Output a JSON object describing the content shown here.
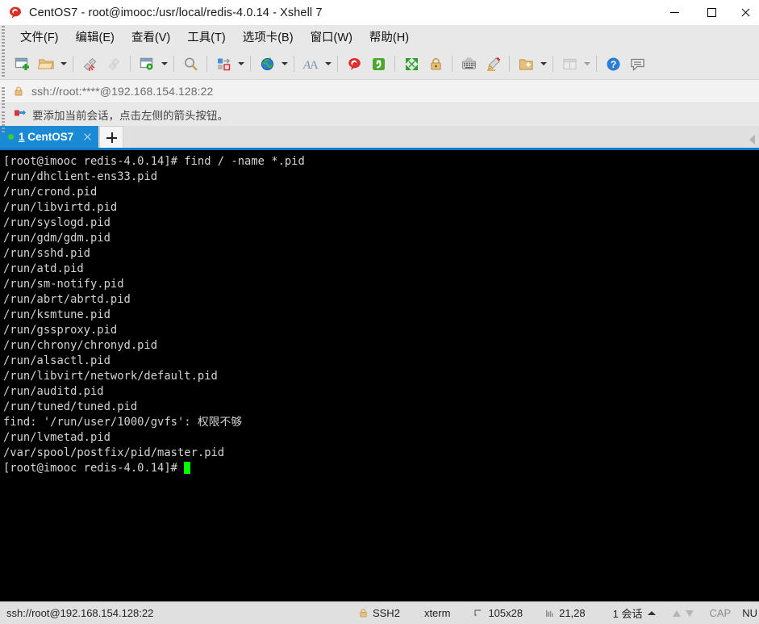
{
  "window": {
    "title": "CentOS7 - root@imooc:/usr/local/redis-4.0.14 - Xshell 7",
    "app_icon": "xshell-logo-icon",
    "controls": {
      "minimize": "minimize",
      "maximize": "maximize",
      "close": "close"
    }
  },
  "menubar": {
    "items": [
      {
        "label": "文件(F)",
        "name": "menu-file"
      },
      {
        "label": "编辑(E)",
        "name": "menu-edit"
      },
      {
        "label": "查看(V)",
        "name": "menu-view"
      },
      {
        "label": "工具(T)",
        "name": "menu-tools"
      },
      {
        "label": "选项卡(B)",
        "name": "menu-tabs"
      },
      {
        "label": "窗口(W)",
        "name": "menu-window"
      },
      {
        "label": "帮助(H)",
        "name": "menu-help"
      }
    ]
  },
  "toolbar": {
    "buttons": [
      {
        "name": "new-session-icon",
        "title": "新建会话"
      },
      {
        "name": "open-folder-icon",
        "title": "打开会话"
      },
      {
        "name": "disconnect-icon",
        "title": "断开连接"
      },
      {
        "name": "reconnect-icon",
        "title": "重新连接"
      },
      {
        "name": "session-properties-icon",
        "title": "属性"
      },
      {
        "name": "search-icon",
        "title": "查找"
      },
      {
        "name": "file-transfer-icon",
        "title": "传输文件"
      },
      {
        "name": "globe-icon",
        "title": "编码"
      },
      {
        "name": "font-icon",
        "title": "字体"
      },
      {
        "name": "xshell-logo-icon",
        "title": "Xshell"
      },
      {
        "name": "xftp-icon",
        "title": "Xftp"
      },
      {
        "name": "fullscreen-icon",
        "title": "全屏"
      },
      {
        "name": "lock-icon",
        "title": "锁定"
      },
      {
        "name": "keyboard-icon",
        "title": "键盘"
      },
      {
        "name": "highlight-pen-icon",
        "title": "高亮"
      },
      {
        "name": "add-folder-icon",
        "title": "添加"
      },
      {
        "name": "layout-icon",
        "title": "排列"
      },
      {
        "name": "help-icon",
        "title": "帮助"
      },
      {
        "name": "feedback-icon",
        "title": "反馈"
      }
    ]
  },
  "address_bar": {
    "lock_icon": "lock-icon",
    "url": "ssh://root:****@192.168.154.128:22"
  },
  "notice_bar": {
    "icon": "arrow-flag-icon",
    "text": "要添加当前会话，点击左侧的箭头按钮。"
  },
  "tabbar": {
    "tabs": [
      {
        "index": "1",
        "label": "CentOS7",
        "status": "connected",
        "name": "tab-centos7"
      }
    ],
    "new_tab": "+",
    "scroll_left": "scroll-left-arrow"
  },
  "terminal": {
    "lines": [
      "[root@imooc redis-4.0.14]# find / -name *.pid",
      "/run/dhclient-ens33.pid",
      "/run/crond.pid",
      "/run/libvirtd.pid",
      "/run/syslogd.pid",
      "/run/gdm/gdm.pid",
      "/run/sshd.pid",
      "/run/atd.pid",
      "/run/sm-notify.pid",
      "/run/abrt/abrtd.pid",
      "/run/ksmtune.pid",
      "/run/gssproxy.pid",
      "/run/chrony/chronyd.pid",
      "/run/alsactl.pid",
      "/run/libvirt/network/default.pid",
      "/run/auditd.pid",
      "/run/tuned/tuned.pid",
      "find: '/run/user/1000/gvfs': 权限不够",
      "/run/lvmetad.pid",
      "/var/spool/postfix/pid/master.pid"
    ],
    "prompt": "[root@imooc redis-4.0.14]# ",
    "background": "#000000",
    "foreground": "#d4d4d4",
    "cursor_color": "#00ff00"
  },
  "statusbar": {
    "connection": "ssh://root@192.168.154.128:22",
    "security_icon": "lock-icon",
    "protocol": "SSH2",
    "term_type": "xterm",
    "size_icon": "resize-icon",
    "size": "105x28",
    "cursor_icon": "cursor-pos-icon",
    "cursor_pos": "21,28",
    "sessions": "1 会话",
    "transfer_up": "upload-arrow-icon",
    "transfer_down": "download-arrow-icon",
    "caps": "CAP",
    "num": "NU"
  }
}
